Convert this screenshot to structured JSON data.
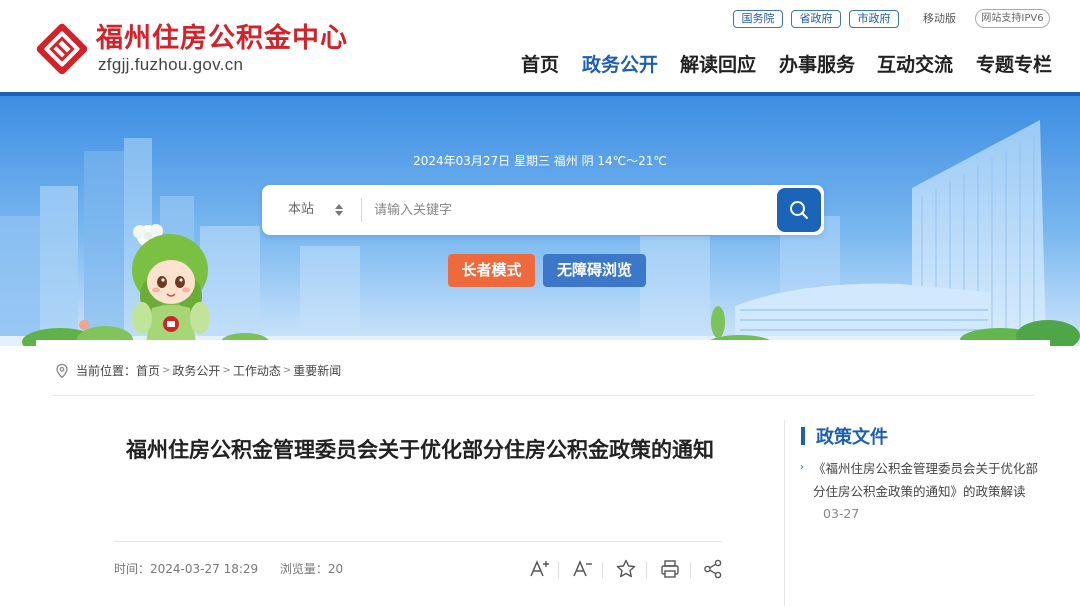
{
  "header": {
    "site_name": "福州住房公积金中心",
    "site_domain": "zfgjj.fuzhou.gov.cn",
    "top_links": [
      "国务院",
      "省政府",
      "市政府"
    ],
    "mobile": "移动版",
    "ipv6": "网站支持IPV6",
    "nav": [
      "首页",
      "政务公开",
      "解读回应",
      "办事服务",
      "互动交流",
      "专题专栏"
    ],
    "active_nav": "政务公开",
    "brand_color": "#d2232a",
    "accent_color": "#1d5fb5"
  },
  "banner": {
    "date_line": "2024年03月27日   星期三   福州 阴 14℃～21℃",
    "search": {
      "scope": "本站",
      "placeholder": "请输入关键字",
      "icon": "search-icon"
    },
    "elder_mode": "长者模式",
    "accessible": "无障碍浏览"
  },
  "breadcrumb": {
    "prefix": "当前位置：",
    "items": [
      "首页",
      "政务公开",
      "工作动态",
      "重要新闻"
    ]
  },
  "article": {
    "title": "福州住房公积金管理委员会关于优化部分住房公积金政策的通知",
    "time_label": "时间：",
    "time": "2024-03-27 18:29",
    "views_label": "浏览量：",
    "views": "20",
    "tools": [
      "font-increase-icon",
      "font-decrease-icon",
      "star-icon",
      "print-icon",
      "share-icon"
    ]
  },
  "sidebar": {
    "title": "政策文件",
    "items": [
      {
        "text": "《福州住房公积金管理委员会关于优化部分住房公积金政策的通知》的政策解读",
        "date": "03-27"
      }
    ]
  }
}
